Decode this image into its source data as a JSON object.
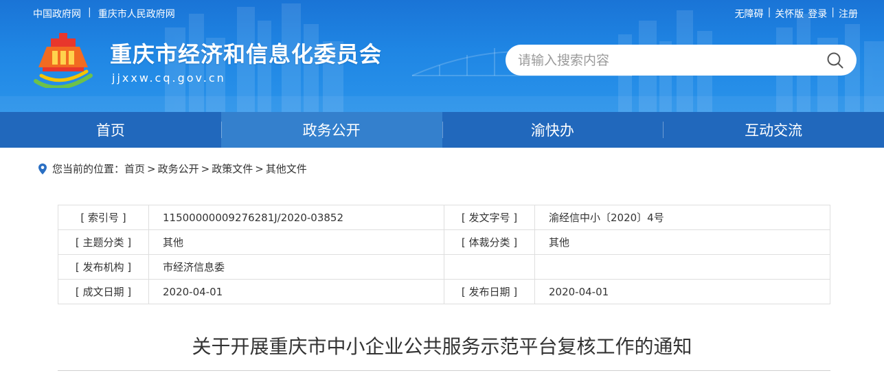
{
  "header": {
    "top_left_links": [
      "中国政府网",
      "重庆市人民政府网"
    ],
    "top_right_links": [
      "无障碍",
      "关怀版",
      "登录",
      "注册"
    ],
    "site_title": "重庆市经济和信息化委员会",
    "site_domain": "jjxxw.cq.gov.cn",
    "search": {
      "placeholder": "请输入搜索内容",
      "value": "",
      "icon": "search-icon"
    },
    "logo_icon": "municipal-emblem-logo"
  },
  "nav": {
    "items": [
      {
        "label": "首页",
        "active": false
      },
      {
        "label": "政务公开",
        "active": true
      },
      {
        "label": "渝快办",
        "active": false
      },
      {
        "label": "互动交流",
        "active": false
      }
    ]
  },
  "breadcrumb": {
    "icon": "location-pin-icon",
    "prefix": "您当前的位置：",
    "items": [
      "首页",
      "政务公开",
      "政策文件",
      "其他文件"
    ],
    "separator": ">"
  },
  "info_table": {
    "rows": [
      {
        "label1": "[ 索引号 ]",
        "value1": "11500000009276281J/2020-03852",
        "label2": "[ 发文字号 ]",
        "value2": "渝经信中小〔2020〕4号"
      },
      {
        "label1": "[ 主题分类 ]",
        "value1": "其他",
        "label2": "[ 体裁分类 ]",
        "value2": "其他"
      },
      {
        "label1": "[ 发布机构 ]",
        "value1": "市经济信息委",
        "label2": "",
        "value2": ""
      },
      {
        "label1": "[ 成文日期 ]",
        "value1": "2020-04-01",
        "label2": "[ 发布日期 ]",
        "value2": "2020-04-01"
      }
    ]
  },
  "document": {
    "title": "关于开展重庆市中小企业公共服务示范平台复核工作的通知"
  },
  "colors": {
    "header_blue": "#1f86e4",
    "nav_blue": "#2168bc",
    "nav_active": "#3480cd",
    "table_border": "#dedede"
  }
}
